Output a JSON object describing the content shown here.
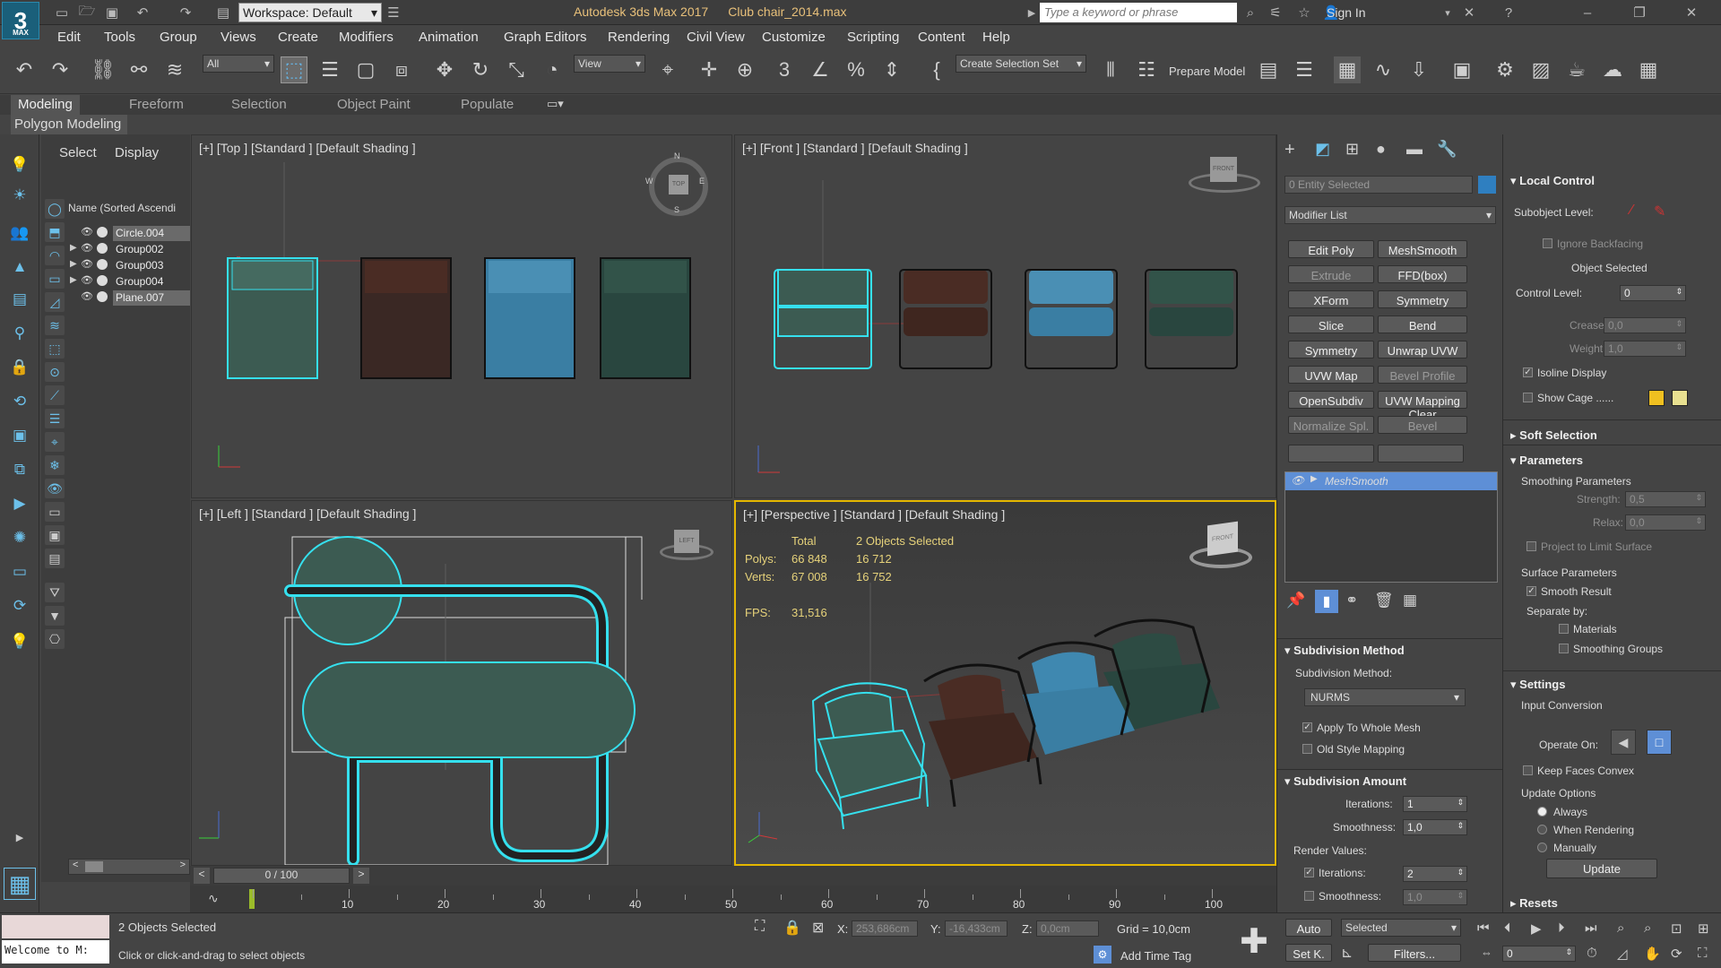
{
  "title_bar": {
    "app": "Autodesk 3ds Max 2017",
    "file": "Club chair_2014.max",
    "workspace": "Workspace: Default",
    "search_placeholder": "Type a keyword or phrase",
    "sign_in": "Sign In"
  },
  "menu": [
    "Edit",
    "Tools",
    "Group",
    "Views",
    "Create",
    "Modifiers",
    "Animation",
    "Graph Editors",
    "Rendering",
    "Civil View",
    "Customize",
    "Scripting",
    "Content",
    "Help"
  ],
  "toolbar": {
    "filter": "All",
    "view": "View",
    "selection_set": "Create Selection Set",
    "prepare_model": "Prepare Model"
  },
  "ribbon": {
    "tabs": [
      "Modeling",
      "Freeform",
      "Selection",
      "Object Paint",
      "Populate"
    ],
    "active_tab": "Modeling",
    "panel": "Polygon Modeling"
  },
  "explorer": {
    "tabs": [
      "Select",
      "Display"
    ],
    "header": "Name (Sorted Ascendi",
    "items": [
      {
        "name": "Circle.004",
        "selected": true,
        "expand": false
      },
      {
        "name": "Group002",
        "selected": false,
        "expand": true
      },
      {
        "name": "Group003",
        "selected": false,
        "expand": true
      },
      {
        "name": "Group004",
        "selected": false,
        "expand": true
      },
      {
        "name": "Plane.007",
        "selected": true,
        "expand": false
      }
    ]
  },
  "viewports": {
    "top": "[+] [Top ] [Standard ] [Default Shading ]",
    "front": "[+] [Front ] [Standard ] [Default Shading ]",
    "left": "[+] [Left ] [Standard ] [Default Shading ]",
    "perspective": "[+] [Perspective ] [Standard ] [Default Shading ]",
    "stats": {
      "total": "Total",
      "selected": "2 Objects Selected",
      "polys_label": "Polys:",
      "polys_total": "66 848",
      "polys_sel": "16 712",
      "verts_label": "Verts:",
      "verts_total": "67 008",
      "verts_sel": "16 752",
      "fps_label": "FPS:",
      "fps": "31,516"
    },
    "viewcube_top": "TOP",
    "viewcube_front": "FRONT",
    "viewcube_left": "LEFT",
    "viewcube_persp": "FRONT",
    "compass": {
      "n": "N",
      "s": "S",
      "e": "E",
      "w": "W"
    }
  },
  "command_panel": {
    "entity": "0 Entity Selected",
    "modifier_list": "Modifier List",
    "buttons": [
      [
        "Edit Poly",
        "MeshSmooth"
      ],
      [
        "Extrude",
        "FFD(box)"
      ],
      [
        "XForm",
        "Symmetry"
      ],
      [
        "Slice",
        "Bend"
      ],
      [
        "Symmetry",
        "Unwrap UVW"
      ],
      [
        "UVW Map",
        "Bevel Profile"
      ],
      [
        "OpenSubdiv",
        "UVW Mapping Clear"
      ],
      [
        "Normalize Spl.",
        "Bevel"
      ]
    ],
    "dim_buttons": [
      "Extrude",
      "Bevel Profile",
      "Normalize Spl.",
      "Bevel"
    ],
    "stack_item": "MeshSmooth",
    "subdivision_method": {
      "title": "Subdivision Method",
      "label": "Subdivision Method:",
      "value": "NURMS",
      "apply_whole": "Apply To Whole Mesh",
      "old_style": "Old Style Mapping"
    },
    "subdivision_amount": {
      "title": "Subdivision Amount",
      "iterations_label": "Iterations:",
      "iterations": "1",
      "smoothness_label": "Smoothness:",
      "smoothness": "1,0",
      "render_values": "Render Values:",
      "r_iterations_label": "Iterations:",
      "r_iterations": "2",
      "r_smoothness_label": "Smoothness:",
      "r_smoothness": "1,0"
    }
  },
  "rollout": {
    "local_control": "Local Control",
    "subobject_level": "Subobject Level:",
    "ignore_backfacing": "Ignore Backfacing",
    "object_selected": "Object Selected",
    "control_level": "Control Level:",
    "control_level_value": "0",
    "crease": "Crease:",
    "crease_value": "0,0",
    "weight": "Weight:",
    "weight_value": "1,0",
    "isoline": "Isoline Display",
    "show_cage": "Show Cage ......",
    "soft_selection": "Soft Selection",
    "parameters": "Parameters",
    "smoothing_params": "Smoothing Parameters",
    "strength": "Strength:",
    "strength_value": "0,5",
    "relax": "Relax:",
    "relax_value": "0,0",
    "project_limit": "Project to Limit Surface",
    "surface_params": "Surface Parameters",
    "smooth_result": "Smooth Result",
    "separate_by": "Separate by:",
    "materials": "Materials",
    "smoothing_groups": "Smoothing Groups",
    "settings": "Settings",
    "input_conversion": "Input Conversion",
    "operate_on": "Operate On:",
    "keep_faces": "Keep Faces Convex",
    "update_options": "Update Options",
    "always": "Always",
    "when_rendering": "When Rendering",
    "manually": "Manually",
    "update": "Update",
    "resets": "Resets"
  },
  "timeline": {
    "frame": "0 / 100",
    "ticks": [
      "10",
      "20",
      "30",
      "40",
      "50",
      "60",
      "70",
      "80",
      "90",
      "100"
    ]
  },
  "status": {
    "welcome": "Welcome to M:",
    "objects_selected": "2 Objects Selected",
    "hint": "Click or click-and-drag to select objects",
    "x_label": "X:",
    "x": "253,686cm",
    "y_label": "Y:",
    "y": "-16,433cm",
    "z_label": "Z:",
    "z": "0,0cm",
    "grid": "Grid = 10,0cm",
    "add_time_tag": "Add Time Tag",
    "auto": "Auto",
    "set_k": "Set K.",
    "selected": "Selected",
    "filters": "Filters...",
    "frame": "0"
  },
  "colors": {
    "selection_cyan": "#35e0ee",
    "chair_green": "#3a5a52",
    "chair_brown": "#4a2a22",
    "chair_blue": "#3b7fa5",
    "chair_dark_green": "#2b4a42",
    "active_border": "#e5b700",
    "stats_yellow": "#e6d27a"
  }
}
